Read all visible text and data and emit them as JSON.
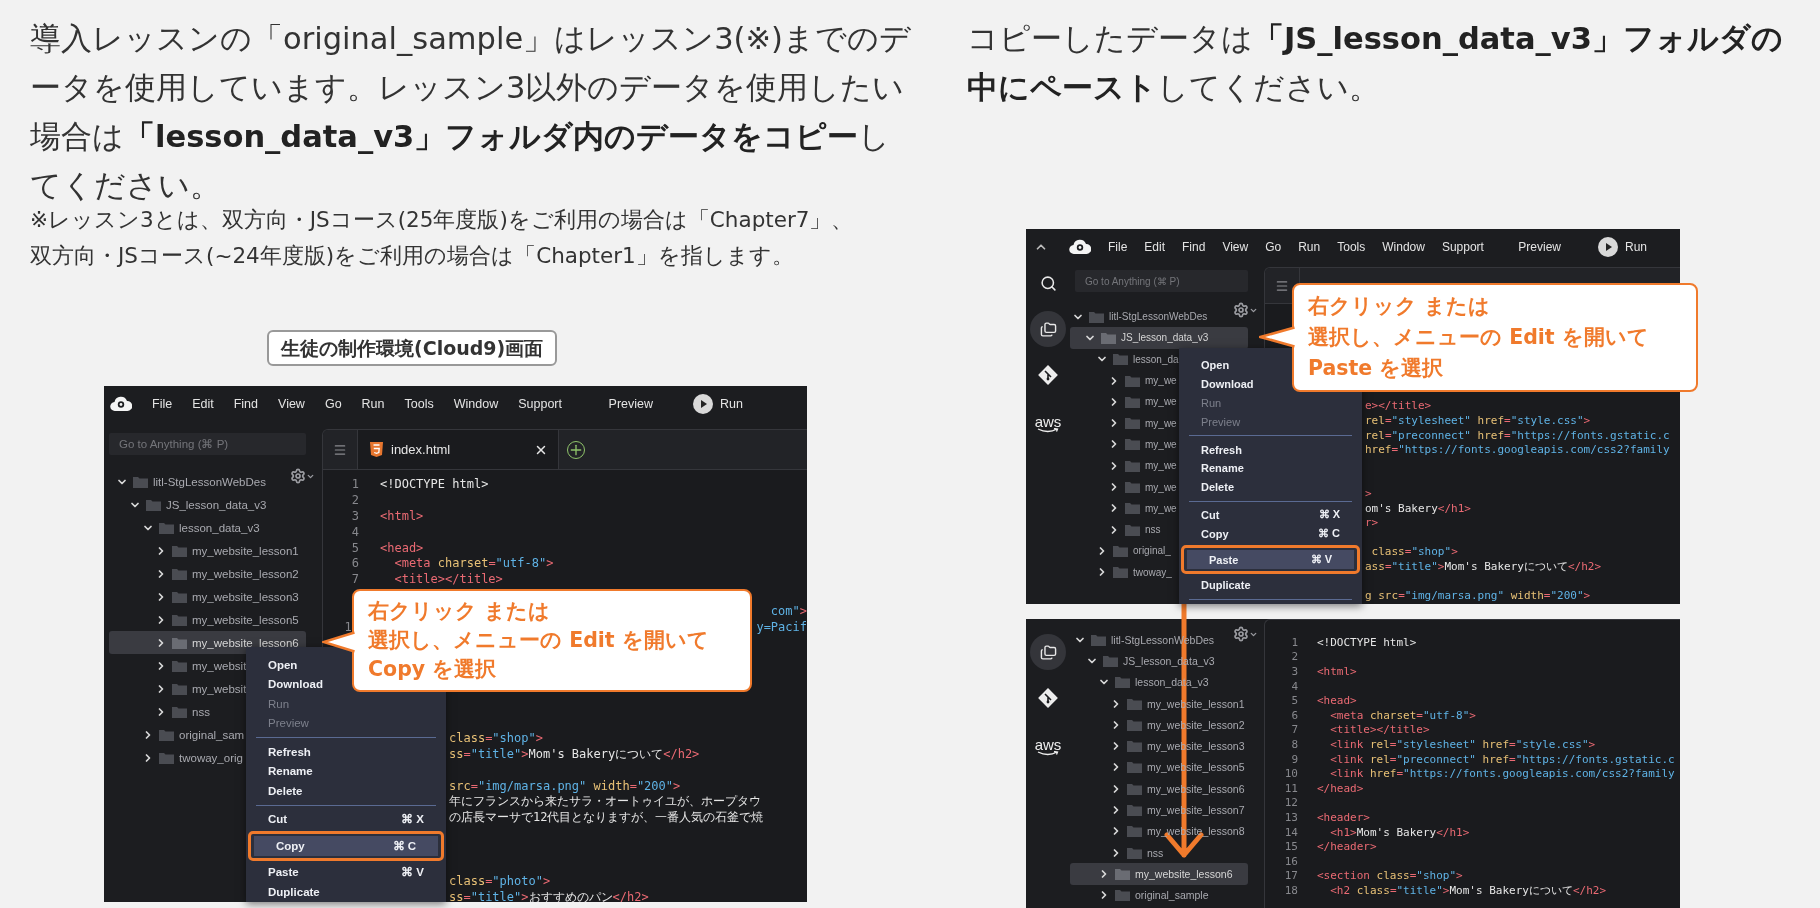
{
  "intro": {
    "text": "導入レッスンの「original_sample」はレッスン3(※)までのデータを使用しています。レッスン3以外のデータを使用したい場合は**「lesson_data_v3」フォルダ内のデータをコピー**してください。",
    "note": "※レッスン3とは、双方向・JSコース(25年度版)をご利用の場合は「Chapter7」、双方向・JSコース(~24年度版)をご利用の場合は「Chapter1」を指します。"
  },
  "caption": "生徒の制作環境(Cloud9)画面",
  "instruction": "コピーしたデータは**「JS_lesson_data_v3」フォルダの中にペースト**してください。",
  "screens": [
    {
      "menu_bar": {
        "toggle": false,
        "items": [
          "File",
          "Edit",
          "Find",
          "View",
          "Go",
          "Run",
          "Tools",
          "Window",
          "Support"
        ],
        "preview": "Preview",
        "run": "Run"
      },
      "search": {
        "placeholder": "Go to Anything (⌘ P)"
      },
      "tree": [
        {
          "name": "litl-StgLessonWebDes",
          "expanded": true,
          "selected": false,
          "children": [
            {
              "name": "JS_lesson_data_v3",
              "expanded": true,
              "selected": false,
              "children": [
                {
                  "name": "lesson_data_v3",
                  "expanded": true,
                  "selected": false,
                  "children": [
                    {
                      "name": "my_website_lesson1",
                      "expanded": false,
                      "selected": false
                    },
                    {
                      "name": "my_website_lesson2",
                      "expanded": false,
                      "selected": false
                    },
                    {
                      "name": "my_website_lesson3",
                      "expanded": false,
                      "selected": false
                    },
                    {
                      "name": "my_website_lesson5",
                      "expanded": false,
                      "selected": false
                    },
                    {
                      "name": "my_website_lesson6",
                      "expanded": false,
                      "selected": true
                    },
                    {
                      "name": "my_websit",
                      "expanded": false,
                      "selected": false
                    },
                    {
                      "name": "my_websit",
                      "expanded": false,
                      "selected": false
                    },
                    {
                      "name": "nss",
                      "expanded": false,
                      "selected": false
                    }
                  ]
                },
                {
                  "name": "original_sam",
                  "expanded": false,
                  "selected": false
                },
                {
                  "name": "twoway_orig",
                  "expanded": false,
                  "selected": false
                }
              ]
            }
          ]
        }
      ],
      "tab_bar": {
        "covered": false,
        "tabs": [
          {
            "title": "index.html",
            "selected": true
          }
        ]
      },
      "code": [
        {
          "num": "1",
          "kind": "full",
          "tokens": [
            {
              "kind": "text",
              "text": "<!DOCTYPE html>"
            }
          ]
        },
        {
          "num": "2",
          "kind": "full"
        },
        {
          "num": "3",
          "kind": "full",
          "tokens": [
            {
              "kind": "tag",
              "text": "<html>"
            }
          ]
        },
        {
          "num": "4",
          "kind": "full"
        },
        {
          "num": "5",
          "kind": "full",
          "tokens": [
            {
              "kind": "tag",
              "text": "<head>"
            }
          ]
        },
        {
          "num": "6",
          "kind": "full",
          "tokens": [
            {
              "kind": "tag",
              "text": "  <meta"
            },
            {
              "kind": "attr",
              "text": " charset"
            },
            {
              "kind": "tag",
              "text": "="
            },
            {
              "kind": "str",
              "text": "\"utf-8\""
            },
            {
              "kind": "tag",
              "text": ">"
            }
          ]
        },
        {
          "num": "7",
          "kind": "full",
          "tokens": [
            {
              "kind": "tag",
              "text": "  <title></title>"
            }
          ]
        },
        {
          "kind": "hidden"
        },
        {
          "kind": "right",
          "tokens": [
            {
              "kind": "str",
              "text": "com\""
            },
            {
              "kind": "tag",
              "text": ">"
            }
          ]
        },
        {
          "num": "1",
          "kind": "right",
          "tokens": [
            {
              "kind": "str",
              "text": "y=Pacif"
            }
          ]
        },
        {
          "kind": "hidden"
        },
        {
          "kind": "hidden"
        },
        {
          "kind": "hidden"
        },
        {
          "kind": "hidden"
        },
        {
          "kind": "hidden"
        },
        {
          "kind": "hidden"
        },
        {
          "kind": "clip",
          "tokens": [
            {
              "kind": "attr",
              "text": "class"
            },
            {
              "kind": "tag",
              "text": "="
            },
            {
              "kind": "str",
              "text": "\"shop\""
            },
            {
              "kind": "tag",
              "text": ">"
            }
          ]
        },
        {
          "kind": "clip",
          "tokens": [
            {
              "kind": "attr",
              "text": "ss"
            },
            {
              "kind": "tag",
              "text": "="
            },
            {
              "kind": "str",
              "text": "\"title\""
            },
            {
              "kind": "tag",
              "text": ">"
            },
            {
              "kind": "text",
              "text": "Mom's Bakeryについて"
            },
            {
              "kind": "tag",
              "text": "</h2>"
            }
          ]
        },
        {
          "kind": "hidden"
        },
        {
          "kind": "clip",
          "tokens": [
            {
              "kind": "attr",
              "text": "src"
            },
            {
              "kind": "tag",
              "text": "="
            },
            {
              "kind": "str",
              "text": "\"img/marsa.png\""
            },
            {
              "kind": "attr",
              "text": " width"
            },
            {
              "kind": "tag",
              "text": "="
            },
            {
              "kind": "str",
              "text": "\"200\""
            },
            {
              "kind": "tag",
              "text": ">"
            }
          ]
        },
        {
          "kind": "clip",
          "tokens": [
            {
              "kind": "text",
              "text": "年にフランスから来たサラ・オートゥイユが、ホープタウ"
            }
          ]
        },
        {
          "kind": "clip",
          "tokens": [
            {
              "kind": "text",
              "text": "の店長マーサで12代目となりますが、一番人気の石釜で焼"
            }
          ]
        },
        {
          "kind": "hidden"
        },
        {
          "kind": "hidden"
        },
        {
          "kind": "hidden"
        },
        {
          "kind": "clip",
          "tokens": [
            {
              "kind": "attr",
              "text": "class"
            },
            {
              "kind": "tag",
              "text": "="
            },
            {
              "kind": "str",
              "text": "\"photo\""
            },
            {
              "kind": "tag",
              "text": ">"
            }
          ]
        },
        {
          "kind": "clip",
          "tokens": [
            {
              "kind": "attr",
              "text": "ss"
            },
            {
              "kind": "tag",
              "text": "="
            },
            {
              "kind": "str",
              "text": "\"title\""
            },
            {
              "kind": "tag",
              "text": ">"
            },
            {
              "kind": "text",
              "text": "おすすめのパン"
            },
            {
              "kind": "tag",
              "text": "</h2>"
            }
          ]
        }
      ],
      "context_menu": [
        {
          "kind": "item",
          "label": "Open",
          "disabled": false,
          "selected": false
        },
        {
          "kind": "item",
          "label": "Download",
          "disabled": false,
          "selected": false
        },
        {
          "kind": "item",
          "label": "Run",
          "disabled": true,
          "selected": false
        },
        {
          "kind": "item",
          "label": "Preview",
          "disabled": true,
          "selected": false
        },
        {
          "kind": "separator"
        },
        {
          "kind": "item",
          "label": "Refresh",
          "disabled": false,
          "selected": false
        },
        {
          "kind": "item",
          "label": "Rename",
          "disabled": false,
          "selected": false
        },
        {
          "kind": "item",
          "label": "Delete",
          "disabled": false,
          "selected": false
        },
        {
          "kind": "separator"
        },
        {
          "kind": "item",
          "label": "Cut",
          "shortcut": "⌘ X",
          "disabled": false,
          "selected": false
        },
        {
          "kind": "item",
          "label": "Copy",
          "shortcut": "⌘ C",
          "disabled": false,
          "selected": true
        },
        {
          "kind": "item",
          "label": "Paste",
          "shortcut": "⌘ V",
          "disabled": false,
          "selected": false
        },
        {
          "kind": "item",
          "label": "Duplicate",
          "disabled": false,
          "selected": false
        }
      ],
      "callout": [
        "右クリック または",
        "選択し、メニューの Edit を開いて",
        "Copy を選択"
      ]
    },
    {
      "menu_bar": {
        "toggle": true,
        "items": [
          "File",
          "Edit",
          "Find",
          "View",
          "Go",
          "Run",
          "Tools",
          "Window",
          "Support"
        ],
        "preview": "Preview",
        "run": "Run"
      },
      "activity_bar": [
        {
          "kind": "search",
          "selected": false
        },
        {
          "kind": "files",
          "selected": true
        },
        {
          "kind": "git",
          "selected": false
        },
        {
          "kind": "aws",
          "label": "aws",
          "selected": false
        }
      ],
      "search": {
        "placeholder": "Go to Anything (⌘ P)"
      },
      "tree": [
        {
          "name": "litl-StgLessonWebDes",
          "expanded": true,
          "selected": false,
          "children": [
            {
              "name": "JS_lesson_data_v3",
              "expanded": true,
              "selected": true,
              "children": [
                {
                  "name": "lesson_da",
                  "expanded": true,
                  "selected": false,
                  "children": [
                    {
                      "name": "my_we",
                      "expanded": false,
                      "selected": false
                    },
                    {
                      "name": "my_we",
                      "expanded": false,
                      "selected": false
                    },
                    {
                      "name": "my_we",
                      "expanded": false,
                      "selected": false
                    },
                    {
                      "name": "my_we",
                      "expanded": false,
                      "selected": false
                    },
                    {
                      "name": "my_we",
                      "expanded": false,
                      "selected": false
                    },
                    {
                      "name": "my_we",
                      "expanded": false,
                      "selected": false
                    },
                    {
                      "name": "my_we",
                      "expanded": false,
                      "selected": false
                    },
                    {
                      "name": "nss",
                      "expanded": false,
                      "selected": false
                    }
                  ]
                },
                {
                  "name": "original_",
                  "expanded": false,
                  "selected": false
                },
                {
                  "name": "twoway_",
                  "expanded": false,
                  "selected": false
                }
              ]
            }
          ]
        }
      ],
      "tab_bar": {
        "covered": true
      },
      "code": [
        {
          "kind": "hidden"
        },
        {
          "kind": "hidden"
        },
        {
          "kind": "hidden"
        },
        {
          "kind": "hidden"
        },
        {
          "kind": "hidden"
        },
        {
          "kind": "hidden"
        },
        {
          "kind": "clip",
          "tokens": [
            {
              "kind": "tag",
              "text": "e></title>"
            }
          ]
        },
        {
          "kind": "clip",
          "tokens": [
            {
              "kind": "attr",
              "text": "rel"
            },
            {
              "kind": "tag",
              "text": "="
            },
            {
              "kind": "str",
              "text": "\"stylesheet\""
            },
            {
              "kind": "attr",
              "text": " href"
            },
            {
              "kind": "tag",
              "text": "="
            },
            {
              "kind": "str",
              "text": "\"style.css\""
            },
            {
              "kind": "tag",
              "text": ">"
            }
          ]
        },
        {
          "kind": "clip",
          "tokens": [
            {
              "kind": "attr",
              "text": "rel"
            },
            {
              "kind": "tag",
              "text": "="
            },
            {
              "kind": "str",
              "text": "\"preconnect\""
            },
            {
              "kind": "attr",
              "text": " href"
            },
            {
              "kind": "tag",
              "text": "="
            },
            {
              "kind": "str",
              "text": "\"https://fonts.gstatic.c"
            }
          ]
        },
        {
          "kind": "clip",
          "tokens": [
            {
              "kind": "attr",
              "text": "href"
            },
            {
              "kind": "tag",
              "text": "="
            },
            {
              "kind": "str",
              "text": "\"https://fonts.googleapis.com/css2?family"
            }
          ]
        },
        {
          "kind": "hidden"
        },
        {
          "kind": "hidden"
        },
        {
          "kind": "clip",
          "tokens": [
            {
              "kind": "tag",
              "text": ">"
            }
          ]
        },
        {
          "kind": "clip",
          "tokens": [
            {
              "kind": "text",
              "text": "om's Bakery"
            },
            {
              "kind": "tag",
              "text": "</h1>"
            }
          ]
        },
        {
          "kind": "clip",
          "tokens": [
            {
              "kind": "tag",
              "text": "r>"
            }
          ]
        },
        {
          "kind": "hidden"
        },
        {
          "kind": "clip",
          "tokens": [
            {
              "kind": "attr",
              "text": " class"
            },
            {
              "kind": "tag",
              "text": "="
            },
            {
              "kind": "str",
              "text": "\"shop\""
            },
            {
              "kind": "tag",
              "text": ">"
            }
          ]
        },
        {
          "kind": "clip",
          "tokens": [
            {
              "kind": "attr",
              "text": "ass"
            },
            {
              "kind": "tag",
              "text": "="
            },
            {
              "kind": "str",
              "text": "\"title\""
            },
            {
              "kind": "tag",
              "text": ">"
            },
            {
              "kind": "text",
              "text": "Mom's Bakeryについて"
            },
            {
              "kind": "tag",
              "text": "</h2>"
            }
          ]
        },
        {
          "kind": "hidden"
        },
        {
          "kind": "clip",
          "tokens": [
            {
              "kind": "attr",
              "text": "g src"
            },
            {
              "kind": "tag",
              "text": "="
            },
            {
              "kind": "str",
              "text": "\"img/marsa.png\""
            },
            {
              "kind": "attr",
              "text": " width"
            },
            {
              "kind": "tag",
              "text": "="
            },
            {
              "kind": "str",
              "text": "\"200\""
            },
            {
              "kind": "tag",
              "text": ">"
            }
          ]
        }
      ],
      "context_menu": [
        {
          "kind": "item",
          "label": "Open",
          "disabled": false,
          "selected": false
        },
        {
          "kind": "item",
          "label": "Download",
          "disabled": false,
          "selected": false
        },
        {
          "kind": "item",
          "label": "Run",
          "disabled": true,
          "selected": false
        },
        {
          "kind": "item",
          "label": "Preview",
          "disabled": true,
          "selected": false
        },
        {
          "kind": "separator"
        },
        {
          "kind": "item",
          "label": "Refresh",
          "disabled": false,
          "selected": false
        },
        {
          "kind": "item",
          "label": "Rename",
          "disabled": false,
          "selected": false
        },
        {
          "kind": "item",
          "label": "Delete",
          "disabled": false,
          "selected": false
        },
        {
          "kind": "separator"
        },
        {
          "kind": "item",
          "label": "Cut",
          "shortcut": "⌘ X",
          "disabled": false,
          "selected": false
        },
        {
          "kind": "item",
          "label": "Copy",
          "shortcut": "⌘ C",
          "disabled": false,
          "selected": false
        },
        {
          "kind": "item",
          "label": "Paste",
          "shortcut": "⌘ V",
          "disabled": false,
          "selected": true
        },
        {
          "kind": "item",
          "label": "Duplicate",
          "disabled": false,
          "selected": false
        },
        {
          "kind": "separator"
        }
      ],
      "callout": [
        "右クリック または",
        "選択し、メニューの Edit を開いて",
        "Paste を選択"
      ]
    },
    {
      "activity_bar": [
        {
          "kind": "files",
          "selected": true
        },
        {
          "kind": "git",
          "selected": false
        },
        {
          "kind": "aws",
          "label": "aws",
          "selected": false
        }
      ],
      "tree": [
        {
          "name": "litl-StgLessonWebDes",
          "expanded": true,
          "selected": false,
          "children": [
            {
              "name": "JS_lesson_data_v3",
              "expanded": true,
              "selected": false,
              "children": [
                {
                  "name": "lesson_data_v3",
                  "expanded": true,
                  "selected": false,
                  "children": [
                    {
                      "name": "my_website_lesson1",
                      "expanded": false,
                      "selected": false
                    },
                    {
                      "name": "my_website_lesson2",
                      "expanded": false,
                      "selected": false
                    },
                    {
                      "name": "my_website_lesson3",
                      "expanded": false,
                      "selected": false
                    },
                    {
                      "name": "my_website_lesson5",
                      "expanded": false,
                      "selected": false
                    },
                    {
                      "name": "my_website_lesson6",
                      "expanded": false,
                      "selected": false
                    },
                    {
                      "name": "my_website_lesson7",
                      "expanded": false,
                      "selected": false
                    },
                    {
                      "name": "my_website_lesson8",
                      "expanded": false,
                      "selected": false
                    },
                    {
                      "name": "nss",
                      "expanded": false,
                      "selected": false
                    }
                  ]
                },
                {
                  "name": "my_website_lesson6",
                  "expanded": false,
                  "selected": true
                },
                {
                  "name": "original_sample",
                  "expanded": false,
                  "selected": false
                }
              ]
            }
          ]
        }
      ],
      "code": [
        {
          "num": "1",
          "kind": "full",
          "tokens": [
            {
              "kind": "text",
              "text": "<!DOCTYPE html>"
            }
          ]
        },
        {
          "num": "2",
          "kind": "full"
        },
        {
          "num": "3",
          "kind": "full",
          "tokens": [
            {
              "kind": "tag",
              "text": "<html>"
            }
          ]
        },
        {
          "num": "4",
          "kind": "full"
        },
        {
          "num": "5",
          "kind": "full",
          "tokens": [
            {
              "kind": "tag",
              "text": "<head>"
            }
          ]
        },
        {
          "num": "6",
          "kind": "full",
          "tokens": [
            {
              "kind": "tag",
              "text": "  <meta"
            },
            {
              "kind": "attr",
              "text": " charset"
            },
            {
              "kind": "tag",
              "text": "="
            },
            {
              "kind": "str",
              "text": "\"utf-8\""
            },
            {
              "kind": "tag",
              "text": ">"
            }
          ]
        },
        {
          "num": "7",
          "kind": "full",
          "tokens": [
            {
              "kind": "tag",
              "text": "  <title></title>"
            }
          ]
        },
        {
          "num": "8",
          "kind": "full",
          "tokens": [
            {
              "kind": "tag",
              "text": "  <link"
            },
            {
              "kind": "attr",
              "text": " rel"
            },
            {
              "kind": "tag",
              "text": "="
            },
            {
              "kind": "str",
              "text": "\"stylesheet\""
            },
            {
              "kind": "attr",
              "text": " href"
            },
            {
              "kind": "tag",
              "text": "="
            },
            {
              "kind": "str",
              "text": "\"style.css\""
            },
            {
              "kind": "tag",
              "text": ">"
            }
          ]
        },
        {
          "num": "9",
          "kind": "full",
          "tokens": [
            {
              "kind": "tag",
              "text": "  <link"
            },
            {
              "kind": "attr",
              "text": " rel"
            },
            {
              "kind": "tag",
              "text": "="
            },
            {
              "kind": "str",
              "text": "\"preconnect\""
            },
            {
              "kind": "attr",
              "text": " href"
            },
            {
              "kind": "tag",
              "text": "="
            },
            {
              "kind": "str",
              "text": "\"https://fonts.gstatic.c"
            }
          ]
        },
        {
          "num": "10",
          "kind": "full",
          "tokens": [
            {
              "kind": "tag",
              "text": "  <link"
            },
            {
              "kind": "attr",
              "text": " href"
            },
            {
              "kind": "tag",
              "text": "="
            },
            {
              "kind": "str",
              "text": "\"https://fonts.googleapis.com/css2?family"
            }
          ]
        },
        {
          "num": "11",
          "kind": "full",
          "tokens": [
            {
              "kind": "tag",
              "text": "</head>"
            }
          ]
        },
        {
          "num": "12",
          "kind": "full"
        },
        {
          "num": "13",
          "kind": "full",
          "tokens": [
            {
              "kind": "tag",
              "text": "<header>"
            }
          ]
        },
        {
          "num": "14",
          "kind": "full",
          "tokens": [
            {
              "kind": "tag",
              "text": "  <h1>"
            },
            {
              "kind": "text",
              "text": "Mom's Bakery"
            },
            {
              "kind": "tag",
              "text": "</h1>"
            }
          ]
        },
        {
          "num": "15",
          "kind": "full",
          "tokens": [
            {
              "kind": "tag",
              "text": "</header>"
            }
          ]
        },
        {
          "num": "16",
          "kind": "full"
        },
        {
          "num": "17",
          "kind": "full",
          "tokens": [
            {
              "kind": "tag",
              "text": "<section"
            },
            {
              "kind": "attr",
              "text": " class"
            },
            {
              "kind": "tag",
              "text": "="
            },
            {
              "kind": "str",
              "text": "\"shop\""
            },
            {
              "kind": "tag",
              "text": ">"
            }
          ]
        },
        {
          "num": "18",
          "kind": "full",
          "tokens": [
            {
              "kind": "tag",
              "text": "  <h2"
            },
            {
              "kind": "attr",
              "text": " class"
            },
            {
              "kind": "tag",
              "text": "="
            },
            {
              "kind": "str",
              "text": "\"title\""
            },
            {
              "kind": "tag",
              "text": ">"
            },
            {
              "kind": "text",
              "text": "Mom's Bakeryについて"
            },
            {
              "kind": "tag",
              "text": "</h2>"
            }
          ]
        }
      ]
    }
  ]
}
